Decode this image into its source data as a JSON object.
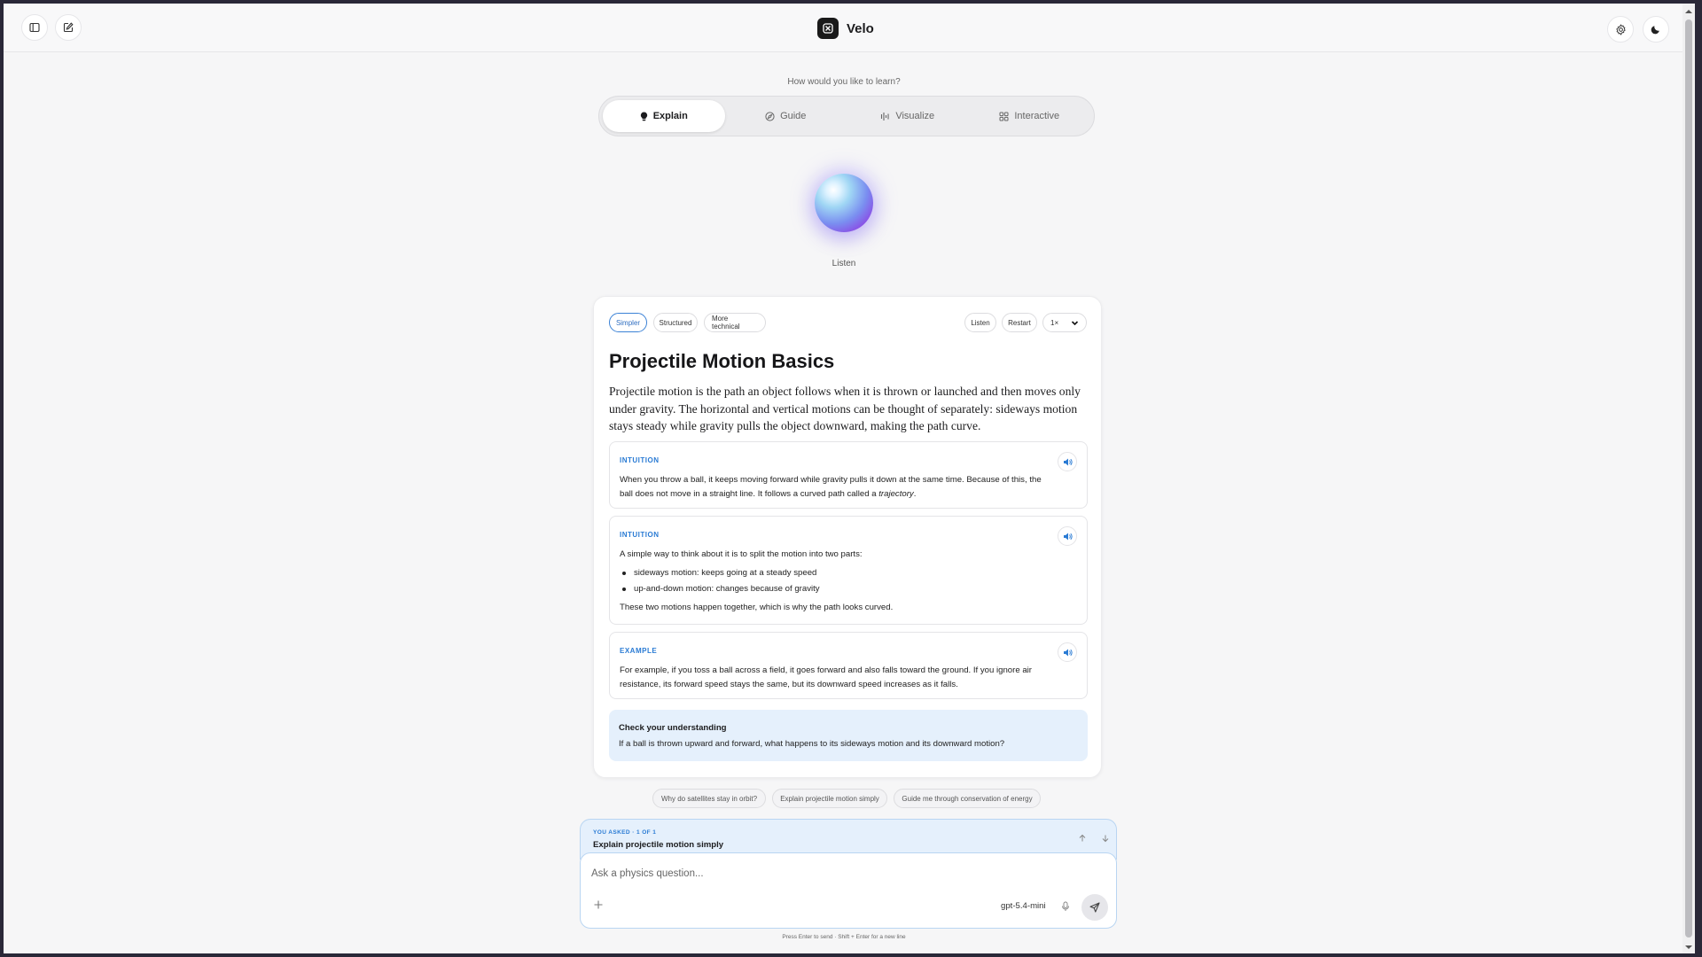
{
  "app": {
    "name": "Velo"
  },
  "modes": {
    "prompt": "How would you like to learn?",
    "tabs": [
      {
        "label": "Explain",
        "icon": "lightbulb-icon",
        "active": true
      },
      {
        "label": "Guide",
        "icon": "compass-icon",
        "active": false
      },
      {
        "label": "Visualize",
        "icon": "waveform-icon",
        "active": false
      },
      {
        "label": "Interactive",
        "icon": "grid-icon",
        "active": false
      }
    ]
  },
  "orb": {
    "label": "Listen"
  },
  "card": {
    "styles": [
      "Simpler",
      "Structured",
      "More technical"
    ],
    "active_style": "Simpler",
    "controls": {
      "listen": "Listen",
      "restart": "Restart",
      "speed": "1×"
    },
    "title": "Projectile Motion Basics",
    "intro": "Projectile motion is the path an object follows when it is thrown or launched and then moves only under gravity. The horizontal and vertical motions can be thought of separately: sideways motion stays steady while gravity pulls the object downward, making the path curve.",
    "sections": [
      {
        "label": "INTUITION",
        "text_before": "When you throw a ball, it keeps moving forward while gravity pulls it down at the same time. Because of this, the ball does not move in a straight line. It follows a curved path called a ",
        "emphasis": "trajectory",
        "text_after": "."
      },
      {
        "label": "INTUITION",
        "lead": "A simple way to think about it is to split the motion into two parts:",
        "bullets": [
          "sideways motion: keeps going at a steady speed",
          "up-and-down motion: changes because of gravity"
        ],
        "closing": "These two motions happen together, which is why the path looks curved."
      },
      {
        "label": "EXAMPLE",
        "text": "For example, if you toss a ball across a field, it goes forward and also falls toward the ground. If you ignore air resistance, its forward speed stays the same, but its downward speed increases as it falls."
      }
    ],
    "check": {
      "title": "Check your understanding",
      "question": "If a ball is thrown upward and forward, what happens to its sideways motion and its downward motion?"
    }
  },
  "suggestions": [
    "Why do satellites stay in orbit?",
    "Explain projectile motion simply",
    "Guide me through conservation of energy"
  ],
  "asked": {
    "label": "YOU ASKED · 1 OF 1",
    "text": "Explain projectile motion simply"
  },
  "composer": {
    "placeholder": "Ask a physics question...",
    "model": "gpt-5.4-mini"
  },
  "hint": "Press Enter to send · Shift + Enter for a new line",
  "colors": {
    "accent": "#2a7bd4",
    "check_bg": "#e5f0fc"
  }
}
